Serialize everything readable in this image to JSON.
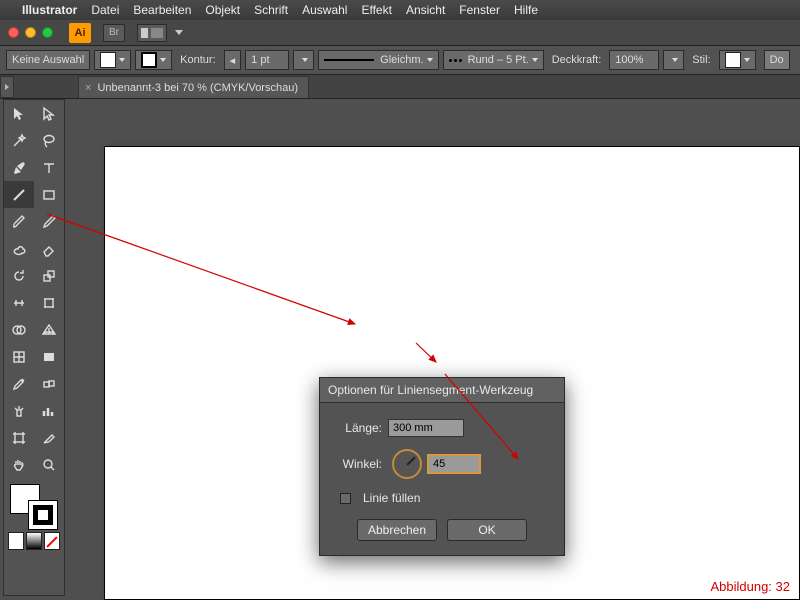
{
  "menubar": {
    "app": "Illustrator",
    "items": [
      "Datei",
      "Bearbeiten",
      "Objekt",
      "Schrift",
      "Auswahl",
      "Effekt",
      "Ansicht",
      "Fenster",
      "Hilfe"
    ]
  },
  "app_top": {
    "ai": "Ai",
    "br": "Br"
  },
  "control_bar": {
    "selection": "Keine Auswahl",
    "kontur_label": "Kontur:",
    "stroke_weight": "1 pt",
    "profile": "Gleichm.",
    "brush": "Rund – 5 Pt.",
    "opacity_label": "Deckkraft:",
    "opacity_value": "100%",
    "style_label": "Stil:",
    "doc_btn": "Do"
  },
  "tab": {
    "close": "×",
    "title": "Unbenannt-3 bei 70 % (CMYK/Vorschau)"
  },
  "dialog": {
    "title": "Optionen für Liniensegment-Werkzeug",
    "length_label": "Länge:",
    "length_value": "300 mm",
    "angle_label": "Winkel:",
    "angle_value": "45",
    "fill_line": "Linie füllen",
    "cancel": "Abbrechen",
    "ok": "OK"
  },
  "caption": "Abbildung: 32",
  "colors": {
    "accent": "#ff9a00",
    "annot": "#d40000"
  }
}
